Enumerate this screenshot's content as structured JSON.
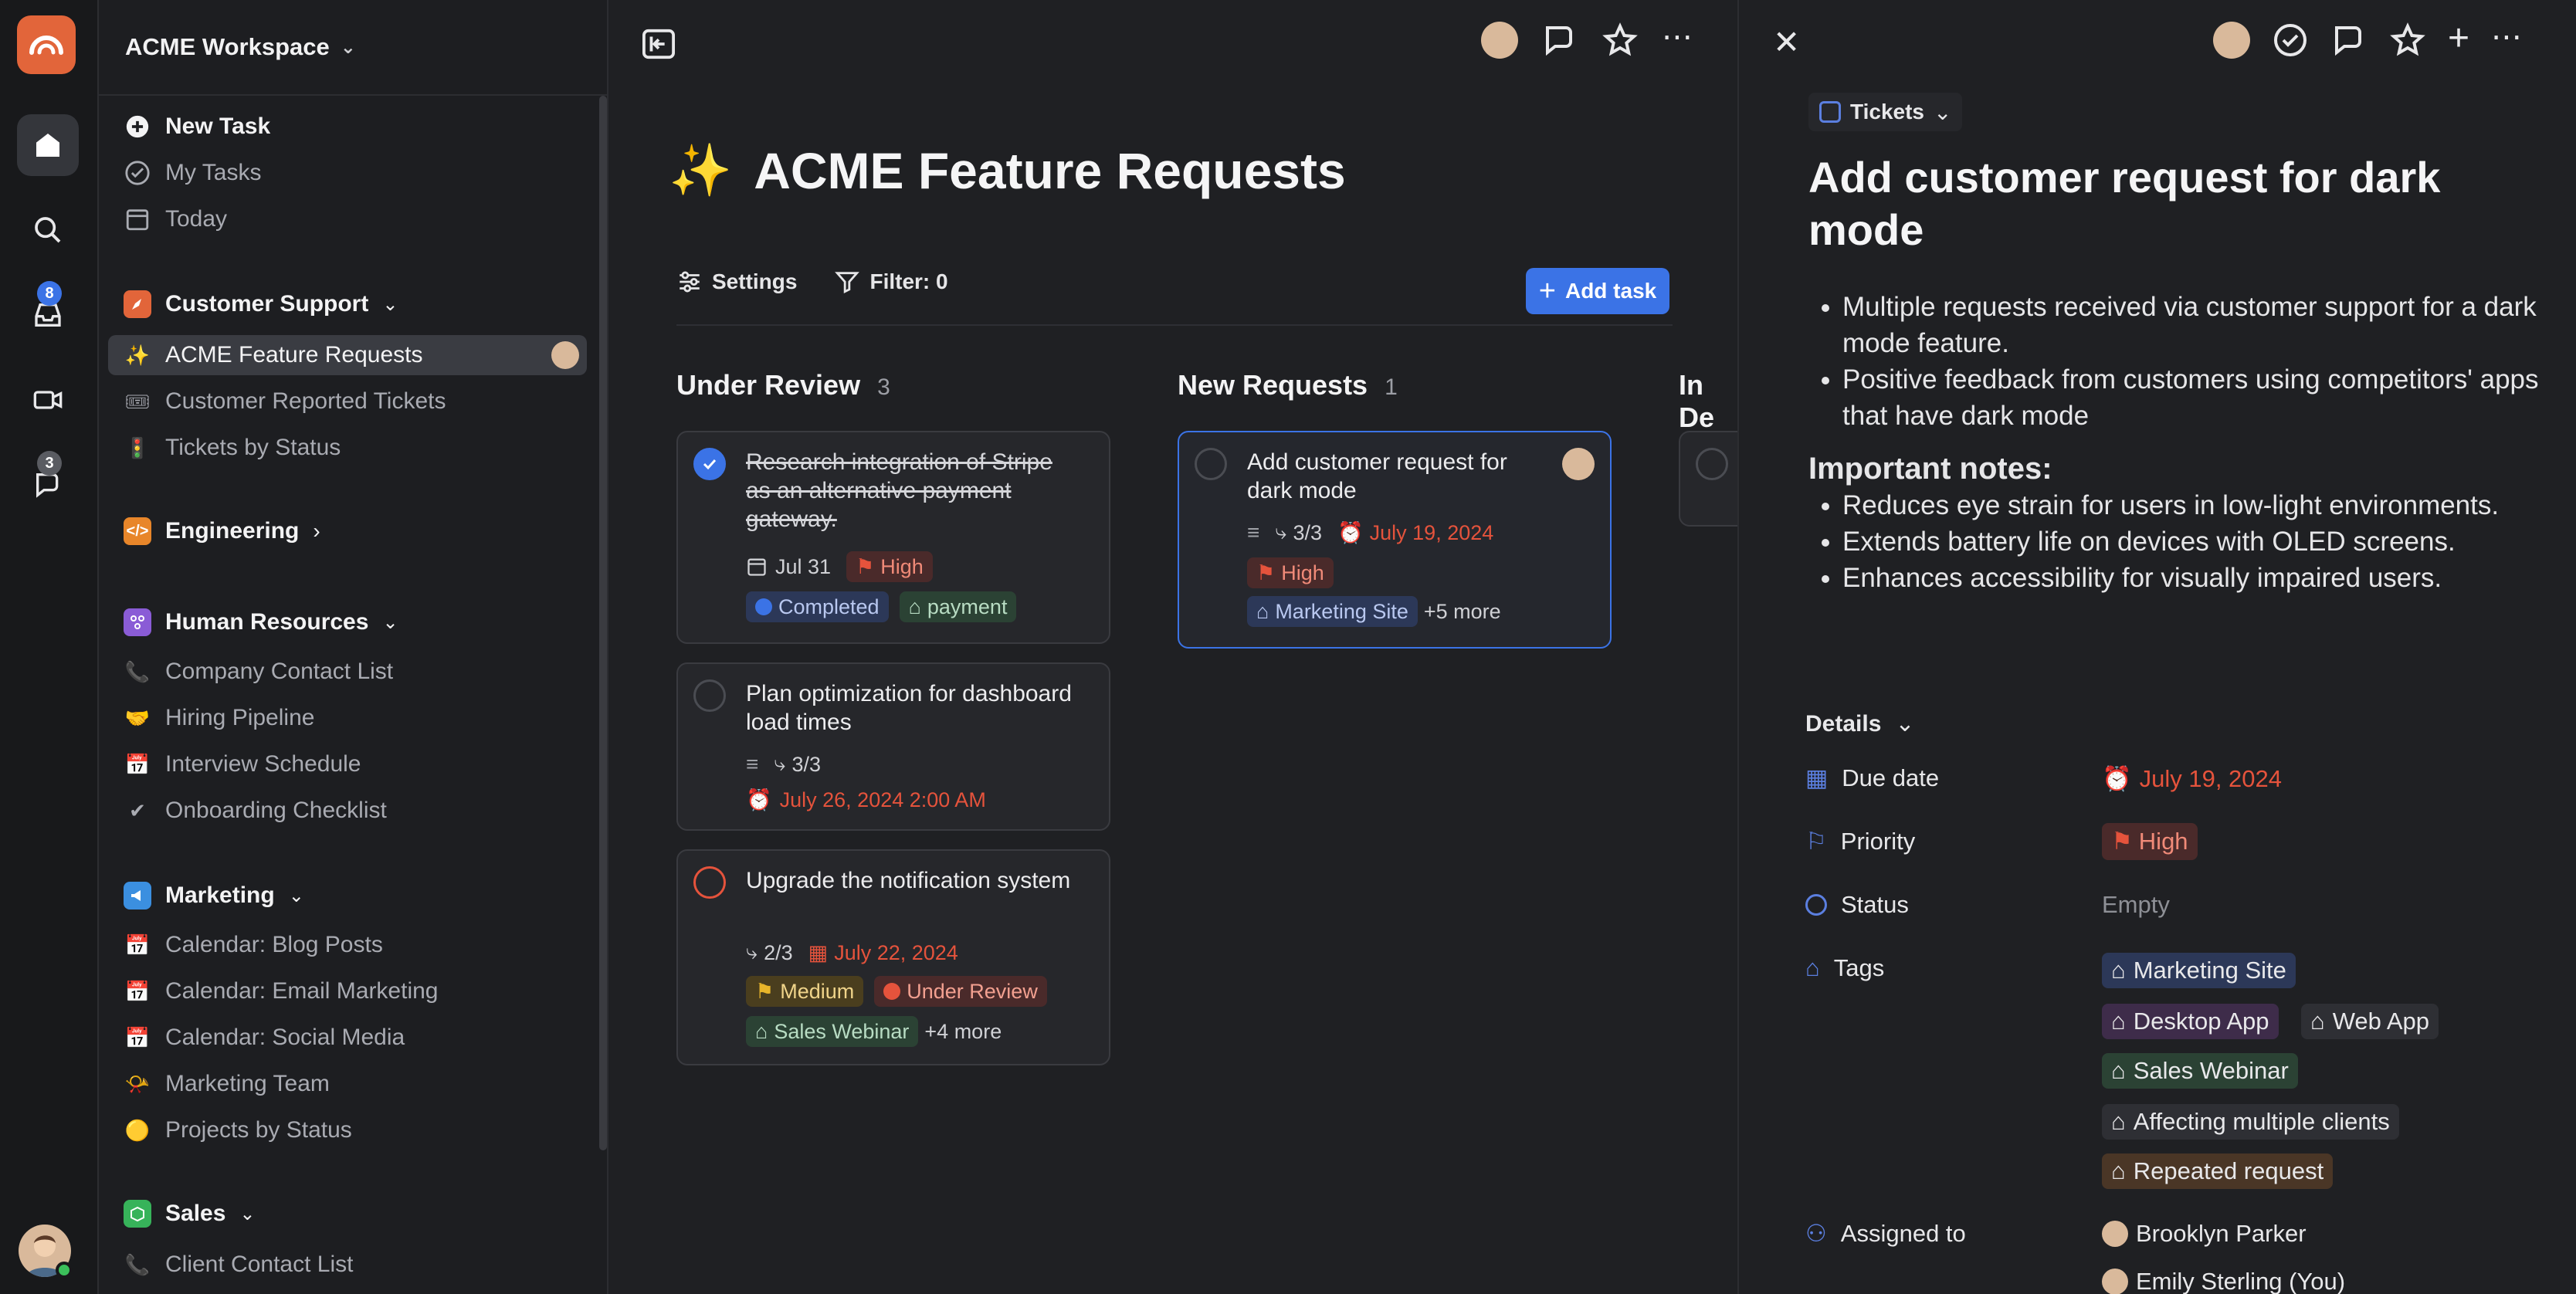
{
  "workspace": {
    "name": "ACME Workspace"
  },
  "rail": {
    "inbox_badge": "8",
    "chat_badge": "3"
  },
  "sidebar": {
    "quick": [
      {
        "label": "New Task",
        "icon": "plus-circle-icon"
      },
      {
        "label": "My Tasks",
        "icon": "check-circle-icon"
      },
      {
        "label": "Today",
        "icon": "calendar-29-icon"
      }
    ],
    "sections": [
      {
        "title": "Customer Support",
        "icon": "rocket-icon",
        "color": "#e2653a",
        "items": [
          {
            "label": "ACME Feature Requests",
            "emoji": "✨"
          },
          {
            "label": "Customer Reported Tickets",
            "emoji": "🎟"
          },
          {
            "label": "Tickets by Status",
            "emoji": "🚦"
          }
        ]
      },
      {
        "title": "Engineering",
        "icon": "code-icon",
        "color": "#e8862a",
        "items": []
      },
      {
        "title": "Human Resources",
        "icon": "org-icon",
        "color": "#8a5cd6",
        "items": [
          {
            "label": "Company Contact List",
            "emoji": "📞"
          },
          {
            "label": "Hiring Pipeline",
            "emoji": "🤝"
          },
          {
            "label": "Interview Schedule",
            "emoji": "📅"
          },
          {
            "label": "Onboarding Checklist",
            "emoji": "✔"
          }
        ]
      },
      {
        "title": "Marketing",
        "icon": "megaphone-icon",
        "color": "#3b8fe0",
        "items": [
          {
            "label": "Calendar: Blog Posts",
            "emoji": "📅"
          },
          {
            "label": "Calendar: Email Marketing",
            "emoji": "📅"
          },
          {
            "label": "Calendar: Social Media",
            "emoji": "📅"
          },
          {
            "label": "Marketing Team",
            "emoji": "📯"
          },
          {
            "label": "Projects by Status",
            "emoji": "🟡"
          }
        ]
      },
      {
        "title": "Sales",
        "icon": "box-icon",
        "color": "#37b35a",
        "items": [
          {
            "label": "Client Contact List",
            "emoji": "📞"
          }
        ]
      }
    ]
  },
  "main": {
    "title": "ACME Feature Requests",
    "title_emoji": "✨",
    "settings": "Settings",
    "filter": "Filter: 0",
    "add_task": "Add task",
    "columns": [
      {
        "name": "Under Review",
        "count": "3"
      },
      {
        "name": "New Requests",
        "count": "1"
      },
      {
        "name": "In De"
      }
    ],
    "cards": {
      "c1": {
        "title": "Research integration of Stripe as an alternative payment gateway.",
        "date": "Jul 31",
        "priority": "High",
        "status": "Completed",
        "tag": "payment"
      },
      "c2": {
        "title": "Plan optimization for dashboard load times",
        "subtasks": "3/3",
        "due": "July 26, 2024 2:00 AM"
      },
      "c3": {
        "title": "Upgrade the notification system",
        "subtasks": "2/3",
        "due": "July 22, 2024",
        "priority": "Medium",
        "status": "Under Review",
        "tag": "Sales Webinar",
        "more": "+4 more"
      },
      "c4": {
        "title": "Add customer request for dark mode",
        "subtasks": "3/3",
        "due": "July 19, 2024",
        "priority": "High",
        "tag": "Marketing Site",
        "more": "+5 more"
      }
    }
  },
  "panel": {
    "breadcrumb": "Tickets",
    "title": "Add customer request for dark mode",
    "bullets1": [
      "Multiple requests received via customer support for a dark mode feature.",
      "Positive feedback from customers using competitors' apps that have dark mode"
    ],
    "notes_heading": "Important notes:",
    "bullets2": [
      "Reduces eye strain for users in low-light environments.",
      "Extends battery life on devices with OLED screens.",
      "Enhances accessibility for visually impaired users."
    ],
    "details_label": "Details",
    "fields": {
      "due_label": "Due date",
      "due": "July 19, 2024",
      "priority_label": "Priority",
      "priority": "High",
      "status_label": "Status",
      "status": "Empty",
      "tags_label": "Tags",
      "assigned_label": "Assigned to"
    },
    "tags": [
      "Marketing Site",
      "Desktop App",
      "Web App",
      "Sales Webinar",
      "Affecting multiple clients",
      "Repeated request"
    ],
    "assignees": [
      "Brooklyn Parker",
      "Emily Sterling (You)"
    ]
  },
  "colors": {
    "accent": "#3b73e6",
    "danger": "#e5533c",
    "bg": "#1f2023"
  }
}
